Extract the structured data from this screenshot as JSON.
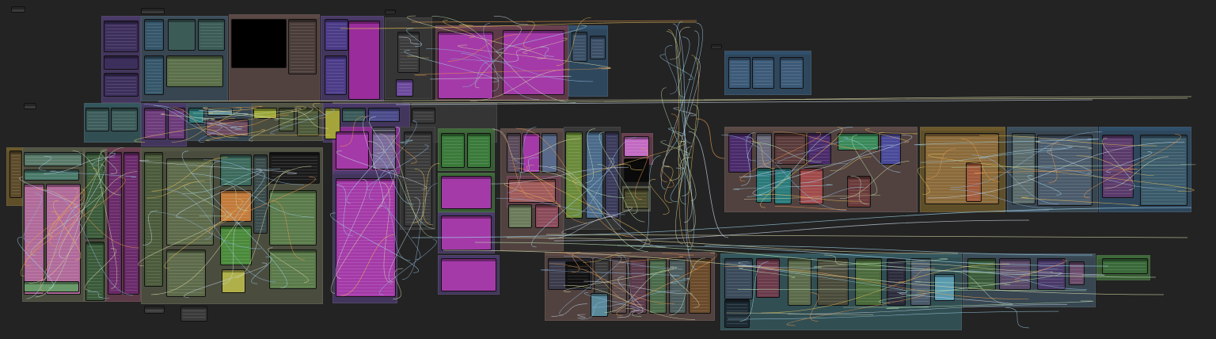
{
  "canvas": {
    "background": "#232323",
    "wire_colors": [
      "#c9d7e6",
      "#9fd3e8",
      "#e8c25a",
      "#d9d9a8",
      "#e89a4f",
      "#b7e0b0",
      "#8fb3d9"
    ],
    "palette": {
      "blue": "#31506b",
      "slate": "#3c4f5c",
      "purple": "#4b3b6b",
      "magenta": "#8c2f8f",
      "brown": "#5c4a46",
      "olive": "#545745",
      "yellow": "#6e5a2a",
      "green": "#3f6a3a",
      "teal": "#35595f",
      "gray": "#3a3a3a",
      "rose": "#6b4050"
    }
  }
}
